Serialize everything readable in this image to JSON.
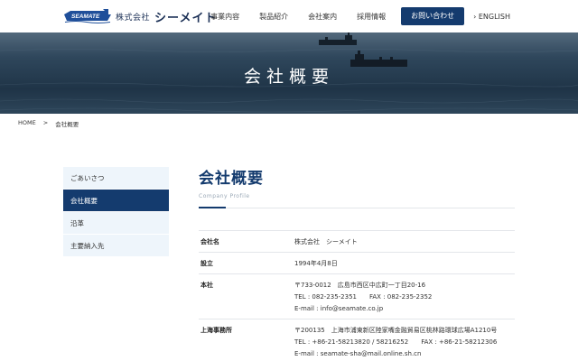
{
  "header": {
    "logo_mark_text": "SEAMATE",
    "logo_company": "株式会社",
    "logo_brand": "シーメイト",
    "nav": [
      "事業内容",
      "製品紹介",
      "会社案内",
      "採用情報"
    ],
    "contact_button": "お問い合わせ",
    "english_link": "› ENGLISH"
  },
  "hero": {
    "title": "会社概要"
  },
  "breadcrumb": {
    "home": "HOME",
    "separator": ">",
    "current": "会社概要"
  },
  "sidebar": {
    "items": [
      {
        "label": "ごあいさつ",
        "active": false
      },
      {
        "label": "会社概要",
        "active": true
      },
      {
        "label": "沿革",
        "active": false
      },
      {
        "label": "主要納入先",
        "active": false
      }
    ]
  },
  "main": {
    "title": "会社概要",
    "subtitle": "Company Profile",
    "rows": [
      {
        "label": "会社名",
        "lines": [
          "株式会社　シーメイト"
        ]
      },
      {
        "label": "設立",
        "lines": [
          "1994年4月8日"
        ]
      },
      {
        "label": "本社",
        "lines": [
          "〒733-0012　広島市西区中広町一丁目20-16",
          "TEL : 082-235-2351　　FAX : 082-235-2352",
          "E-mail : info@seamate.co.jp"
        ]
      },
      {
        "label": "上海事務所",
        "lines": [
          "〒200135　上海市浦東新区陸家嘴金融貿易区桃林路環球広場A1210号",
          "TEL : +86-21-58213820 / 58216252　　FAX : +86-21-58212306",
          "E-mail : seamate-sha@mail.online.sh.cn"
        ]
      }
    ]
  },
  "colors": {
    "brand_navy": "#143b6e",
    "sidebar_bg": "#eef5fb",
    "rule": "#e3e6ea"
  }
}
